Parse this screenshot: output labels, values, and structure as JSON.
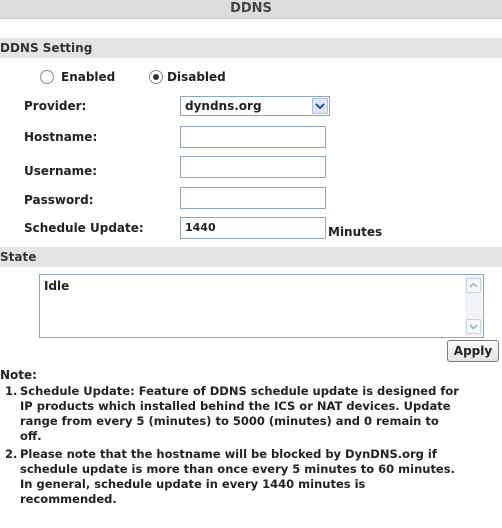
{
  "title": "DDNS",
  "ddns_setting": {
    "heading": "DDNS Setting",
    "enabled_label": "Enabled",
    "disabled_label": "Disabled",
    "selected": "Disabled",
    "provider_label": "Provider:",
    "provider_value": "dyndns.org",
    "hostname_label": "Hostname:",
    "hostname_value": "",
    "username_label": "Username:",
    "username_value": "",
    "password_label": "Password:",
    "password_value": "",
    "schedule_label": "Schedule Update:",
    "schedule_value": "1440",
    "schedule_unit": "Minutes"
  },
  "state": {
    "heading": "State",
    "value": "Idle"
  },
  "apply_label": "Apply",
  "note": {
    "heading": "Note:",
    "item1_num": "1.",
    "item1_lines": [
      "Schedule Update: Feature of DDNS schedule update is designed for",
      "IP products which installed behind the ICS or NAT devices. Update",
      "range from every 5 (minutes) to 5000 (minutes) and 0 remain to",
      "off."
    ],
    "item2_num": "2.",
    "item2_lines": [
      "Please note that the hostname will be blocked by DynDNS.org if",
      "schedule update is more than once every 5 minutes to 60 minutes.",
      "In general, schedule update in every 1440 minutes is",
      "recommended."
    ]
  },
  "icons": {
    "chevron": "chevron-down-icon",
    "scroll_up": "scroll-up-icon",
    "scroll_down": "scroll-down-icon"
  }
}
